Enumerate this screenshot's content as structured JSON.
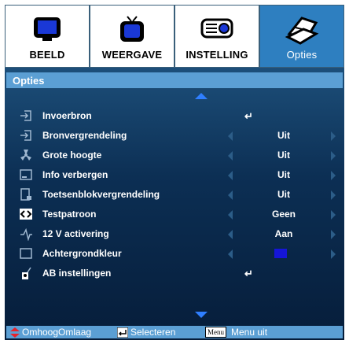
{
  "tabs": [
    {
      "label": "BEELD",
      "icon": "monitor-icon",
      "active": false
    },
    {
      "label": "WEERGAVE",
      "icon": "tv-icon",
      "active": false
    },
    {
      "label": "INSTELLING",
      "icon": "projector-icon",
      "active": false
    },
    {
      "label": "Opties",
      "icon": "options-icon",
      "active": true
    }
  ],
  "panel": {
    "title": "Opties",
    "rows": [
      {
        "label": "Invoerbron",
        "icon": "input-source-icon",
        "value": "↵",
        "kind": "enter"
      },
      {
        "label": "Bronvergrendeling",
        "icon": "source-lock-icon",
        "value": "Uit",
        "kind": "select"
      },
      {
        "label": "Grote hoogte",
        "icon": "high-altitude-icon",
        "value": "Uit",
        "kind": "select"
      },
      {
        "label": "Info verbergen",
        "icon": "info-hide-icon",
        "value": "Uit",
        "kind": "select"
      },
      {
        "label": "Toetsenblokvergrendeling",
        "icon": "keypad-lock-icon",
        "value": "Uit",
        "kind": "select"
      },
      {
        "label": "Testpatroon",
        "icon": "test-pattern-icon",
        "value": "Geen",
        "kind": "select"
      },
      {
        "label": "12 V activering",
        "icon": "12v-trigger-icon",
        "value": "Aan",
        "kind": "select"
      },
      {
        "label": "Achtergrondkleur",
        "icon": "background-color-icon",
        "value": "",
        "kind": "color"
      },
      {
        "label": "AB instellingen",
        "icon": "advanced-settings-icon",
        "value": "↵",
        "kind": "enter"
      }
    ]
  },
  "hints": {
    "updown": "OmhoogOmlaag",
    "select": "Selecteren",
    "menu_key": "Menu",
    "menu": "Menu uit"
  },
  "colors": {
    "active_tab": "#2e7fc0",
    "panel_bar": "#5b9fd4",
    "arrow": "#2f7fff",
    "background_swatch": "#1515d8",
    "updown_arrow": "#e8232a"
  }
}
